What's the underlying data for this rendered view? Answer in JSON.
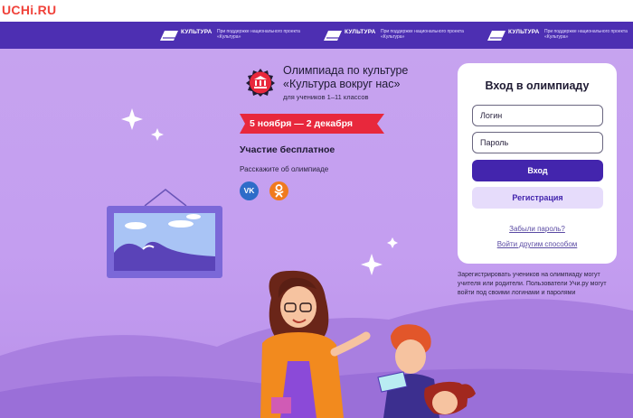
{
  "header": {
    "logo": "UCHi.RU"
  },
  "partners": [
    {
      "name": "КУЛЬТУРА",
      "note": "При поддержке национального проекта «Культура»"
    },
    {
      "name": "КУЛЬТУРА",
      "note": "При поддержке национального проекта «Культура»"
    },
    {
      "name": "КУЛЬТУРА",
      "note": "При поддержке национального проекта «Культура»"
    }
  ],
  "olympiad": {
    "title_line1": "Олимпиада по культуре",
    "title_line2": "«Культура вокруг нас»",
    "subtitle": "для учеников 1–11 классов",
    "dates": "5 ноября — 2 декабря",
    "free": "Участие бесплатное",
    "share_label": "Расскажите об олимпиаде",
    "share_vk": "VK"
  },
  "login": {
    "title": "Вход в олимпиаду",
    "login_placeholder": "Логин",
    "password_placeholder": "Пароль",
    "enter_button": "Вход",
    "register_button": "Регистрация",
    "forgot_link": "Забыли пароль?",
    "other_link": "Войти другим способом"
  },
  "registration_note": "Зарегистрировать учеников на олимпиаду могут учителя или родители. Пользователи Учи.ру могут войти под своими логинами и паролями",
  "colors": {
    "background": "#c9a4ee",
    "banner": "#4d2fb2",
    "accent": "#4325ad",
    "ribbon": "#e8283c",
    "logo": "#f0423a"
  }
}
